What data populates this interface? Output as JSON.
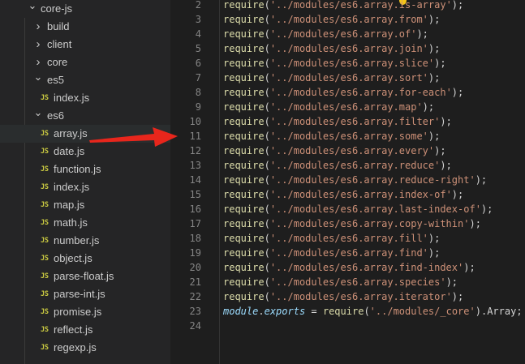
{
  "explorer": {
    "items": [
      {
        "label": "core-js",
        "kind": "folder",
        "expanded": true,
        "depth": 0
      },
      {
        "label": "build",
        "kind": "folder",
        "expanded": false,
        "depth": 1
      },
      {
        "label": "client",
        "kind": "folder",
        "expanded": false,
        "depth": 1
      },
      {
        "label": "core",
        "kind": "folder",
        "expanded": false,
        "depth": 1
      },
      {
        "label": "es5",
        "kind": "folder",
        "expanded": true,
        "depth": 1
      },
      {
        "label": "index.js",
        "kind": "file",
        "depth": 2
      },
      {
        "label": "es6",
        "kind": "folder",
        "expanded": true,
        "depth": 1
      },
      {
        "label": "array.js",
        "kind": "file",
        "depth": 2
      },
      {
        "label": "date.js",
        "kind": "file",
        "depth": 2
      },
      {
        "label": "function.js",
        "kind": "file",
        "depth": 2
      },
      {
        "label": "index.js",
        "kind": "file",
        "depth": 2
      },
      {
        "label": "map.js",
        "kind": "file",
        "depth": 2
      },
      {
        "label": "math.js",
        "kind": "file",
        "depth": 2
      },
      {
        "label": "number.js",
        "kind": "file",
        "depth": 2
      },
      {
        "label": "object.js",
        "kind": "file",
        "depth": 2
      },
      {
        "label": "parse-float.js",
        "kind": "file",
        "depth": 2
      },
      {
        "label": "parse-int.js",
        "kind": "file",
        "depth": 2
      },
      {
        "label": "promise.js",
        "kind": "file",
        "depth": 2
      },
      {
        "label": "reflect.js",
        "kind": "file",
        "depth": 2
      },
      {
        "label": "regexp.js",
        "kind": "file",
        "depth": 2
      }
    ],
    "js_badge": "JS",
    "chevron_open": "⌄",
    "chevron_closed": "›"
  },
  "editor": {
    "lines": [
      {
        "n": "2",
        "path": "../modules/es6.array.is-array"
      },
      {
        "n": "3",
        "path": "../modules/es6.array.from"
      },
      {
        "n": "4",
        "path": "../modules/es6.array.of"
      },
      {
        "n": "5",
        "path": "../modules/es6.array.join"
      },
      {
        "n": "6",
        "path": "../modules/es6.array.slice"
      },
      {
        "n": "7",
        "path": "../modules/es6.array.sort"
      },
      {
        "n": "8",
        "path": "../modules/es6.array.for-each"
      },
      {
        "n": "9",
        "path": "../modules/es6.array.map"
      },
      {
        "n": "10",
        "path": "../modules/es6.array.filter"
      },
      {
        "n": "11",
        "path": "../modules/es6.array.some"
      },
      {
        "n": "12",
        "path": "../modules/es6.array.every"
      },
      {
        "n": "13",
        "path": "../modules/es6.array.reduce"
      },
      {
        "n": "14",
        "path": "../modules/es6.array.reduce-right"
      },
      {
        "n": "15",
        "path": "../modules/es6.array.index-of"
      },
      {
        "n": "16",
        "path": "../modules/es6.array.last-index-of"
      },
      {
        "n": "17",
        "path": "../modules/es6.array.copy-within"
      },
      {
        "n": "18",
        "path": "../modules/es6.array.fill"
      },
      {
        "n": "19",
        "path": "../modules/es6.array.find"
      },
      {
        "n": "20",
        "path": "../modules/es6.array.find-index"
      },
      {
        "n": "21",
        "path": "../modules/es6.array.species"
      },
      {
        "n": "22",
        "path": "../modules/es6.array.iterator"
      }
    ],
    "require_kw": "require",
    "export_line": {
      "n": "23",
      "module": "module",
      "exports": "exports",
      "eq": " = ",
      "path": "../modules/_core",
      "tail": ".Array;"
    },
    "empty_line": {
      "n": "24"
    }
  },
  "colors": {
    "arrow": "#e8261c",
    "bulb": "#f5c518"
  }
}
